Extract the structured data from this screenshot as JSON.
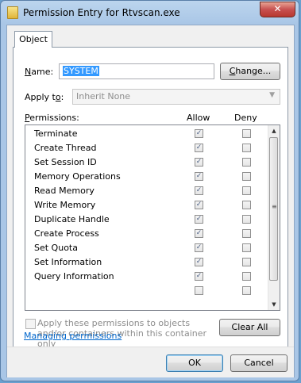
{
  "window": {
    "title": "Permission Entry for Rtvscan.exe",
    "close_glyph": "✕"
  },
  "tab": {
    "label": "Object"
  },
  "name": {
    "label": "Name:",
    "value": "SYSTEM",
    "change_button": "Change..."
  },
  "apply_to": {
    "label": "Apply to:",
    "value": "Inherit None"
  },
  "permissions": {
    "label": "Permissions:",
    "allow_header": "Allow",
    "deny_header": "Deny",
    "items": [
      {
        "name": "Terminate",
        "allow": true,
        "deny": false
      },
      {
        "name": "Create Thread",
        "allow": true,
        "deny": false
      },
      {
        "name": "Set Session ID",
        "allow": true,
        "deny": false
      },
      {
        "name": "Memory Operations",
        "allow": true,
        "deny": false
      },
      {
        "name": "Read Memory",
        "allow": true,
        "deny": false
      },
      {
        "name": "Write Memory",
        "allow": true,
        "deny": false
      },
      {
        "name": "Duplicate Handle",
        "allow": true,
        "deny": false
      },
      {
        "name": "Create Process",
        "allow": true,
        "deny": false
      },
      {
        "name": "Set Quota",
        "allow": true,
        "deny": false
      },
      {
        "name": "Set Information",
        "allow": true,
        "deny": false
      },
      {
        "name": "Query Information",
        "allow": true,
        "deny": false
      }
    ]
  },
  "apply_children": {
    "text": "Apply these permissions to objects and/or containers within this container only",
    "checked": false
  },
  "clear_all_button": "Clear All",
  "managing_link": "Managing permissions",
  "ok_button": "OK",
  "cancel_button": "Cancel"
}
